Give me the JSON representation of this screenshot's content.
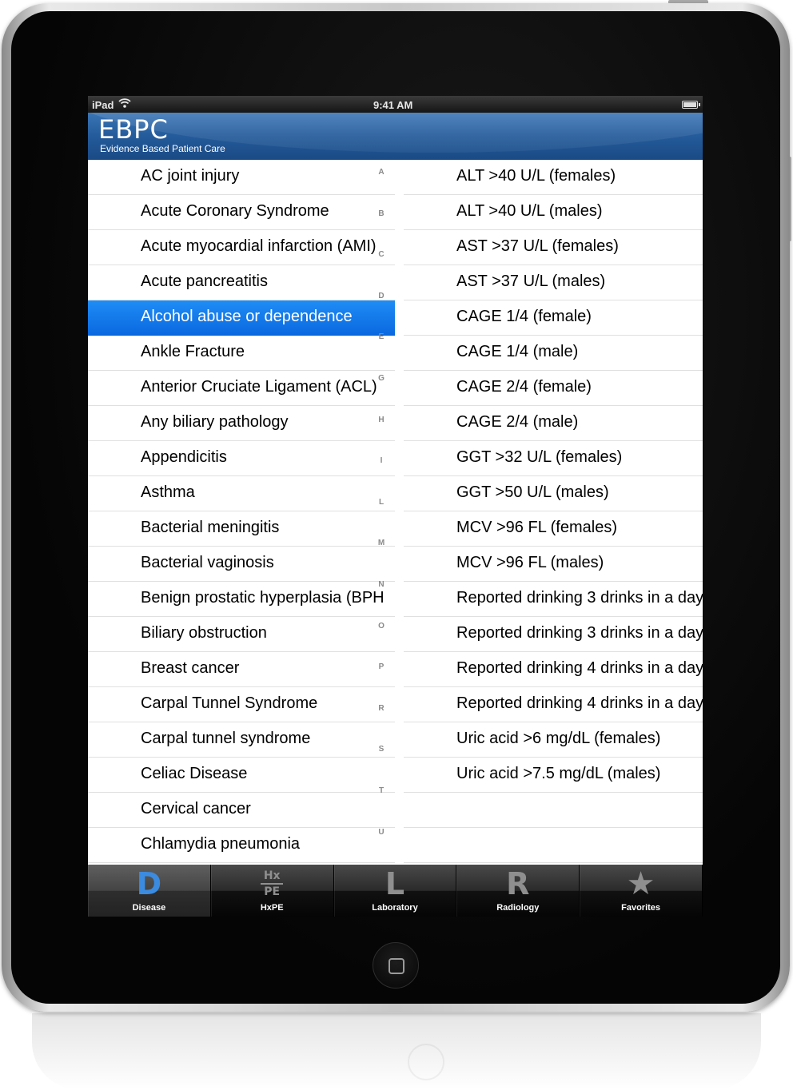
{
  "status": {
    "carrier": "iPad",
    "time": "9:41 AM"
  },
  "header": {
    "logo": "EBPC",
    "tagline": "Evidence Based Patient Care"
  },
  "diseases": [
    "AC joint injury",
    "Acute Coronary Syndrome",
    "Acute myocardial infarction (AMI)",
    "Acute pancreatitis",
    "Alcohol abuse or dependence",
    "Ankle Fracture",
    "Anterior Cruciate Ligament (ACL)",
    "Any biliary pathology",
    "Appendicitis",
    "Asthma",
    "Bacterial meningitis",
    "Bacterial vaginosis",
    "Benign prostatic hyperplasia (BPH",
    "Biliary obstruction",
    "Breast cancer",
    "Carpal Tunnel Syndrome",
    "Carpal tunnel syndrome",
    "Celiac Disease",
    "Cervical cancer",
    "Chlamydia pneumonia"
  ],
  "selected_disease": "Alcohol abuse or dependence",
  "index_letters": [
    "A",
    "B",
    "C",
    "D",
    "E",
    "G",
    "H",
    "I",
    "L",
    "M",
    "N",
    "O",
    "P",
    "R",
    "S",
    "T",
    "U"
  ],
  "findings": [
    "ALT >40 U/L (females)",
    "ALT >40 U/L (males)",
    "AST >37 U/L (females)",
    "AST >37 U/L (males)",
    "CAGE 1/4 (female)",
    "CAGE 1/4 (male)",
    "CAGE 2/4 (female)",
    "CAGE 2/4 (male)",
    "GGT >32 U/L (females)",
    "GGT >50 U/L (males)",
    "MCV >96 FL (females)",
    "MCV >96 FL (males)",
    "Reported drinking 3 drinks in a day",
    "Reported drinking 3 drinks in a day",
    "Reported drinking 4 drinks in a day",
    "Reported drinking 4 drinks in a day",
    "Uric acid >6 mg/dL (females)",
    "Uric acid >7.5 mg/dL (males)",
    "",
    ""
  ],
  "tabs": [
    {
      "label": "Disease",
      "glyph": "D",
      "icon": "disease-icon",
      "active": true
    },
    {
      "label": "HxPE",
      "glyph_top": "Hx",
      "glyph_bottom": "PE",
      "icon": "hxpe-icon",
      "active": false
    },
    {
      "label": "Laboratory",
      "glyph": "L",
      "icon": "laboratory-icon",
      "active": false
    },
    {
      "label": "Radiology",
      "glyph": "R",
      "icon": "radiology-icon",
      "active": false
    },
    {
      "label": "Favorites",
      "glyph": "★",
      "icon": "star-icon",
      "active": false
    }
  ],
  "colors": {
    "header": "#245b9a",
    "selection": "#1f8df5",
    "tab_active": "#3b8be0"
  }
}
